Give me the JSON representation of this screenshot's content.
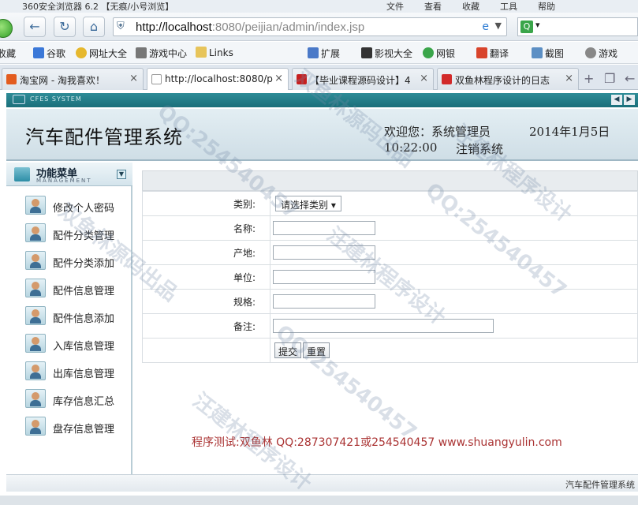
{
  "browser": {
    "title": "360安全浏览器 6.2 【无痕/小号浏览】",
    "menus": [
      "文件",
      "查看",
      "收藏",
      "工具",
      "帮助"
    ],
    "url_host": "http://localhost",
    "url_path": ":8080/peijian/admin/index.jsp",
    "bookmarks": [
      "收藏",
      "谷歌",
      "网址大全",
      "游戏中心",
      "Links",
      "扩展",
      "影视大全",
      "网银",
      "翻译",
      "截图",
      "游戏"
    ],
    "tabs": [
      {
        "label": "淘宝网 - 淘我喜欢！",
        "color": "#e35c1f"
      },
      {
        "label": "http://localhost:8080/p",
        "color": "#e8e8e8"
      },
      {
        "label": "【毕业课程源码设计】4",
        "color": "#c62020"
      },
      {
        "label": "双鱼林程序设计的日志",
        "color": "#d22a2a"
      }
    ]
  },
  "app": {
    "system_badge": "CFES SYSTEM",
    "title": "汽车配件管理系统",
    "welcome": "欢迎您：系统管理员",
    "date": "2014年1月5日",
    "time": "10:22:00",
    "logout": "注销系统",
    "menu": {
      "title": "功能菜单",
      "subtitle": "MANAGEMENT",
      "items": [
        "修改个人密码",
        "配件分类管理",
        "配件分类添加",
        "配件信息管理",
        "配件信息添加",
        "入库信息管理",
        "出库信息管理",
        "库存信息汇总",
        "盘存信息管理"
      ]
    },
    "form": {
      "category_label": "类别:",
      "category_value": "请选择类别",
      "name_label": "名称:",
      "origin_label": "产地:",
      "unit_label": "单位:",
      "spec_label": "规格:",
      "remark_label": "备注:",
      "submit": "提交",
      "reset": "重置"
    },
    "footer_note": "程序测试:双鱼林 QQ:287307421或254540457 www.shuangyulin.com",
    "bottom_label": "汽车配件管理系统"
  },
  "watermarks": [
    "QQ:254540457",
    "汪建林程序设计",
    "双鱼林源码出品",
    "QQ:254540457",
    "汪建林程序设计",
    "双鱼林源码出品",
    "QQ:254540457",
    "汪建林程序设计"
  ]
}
